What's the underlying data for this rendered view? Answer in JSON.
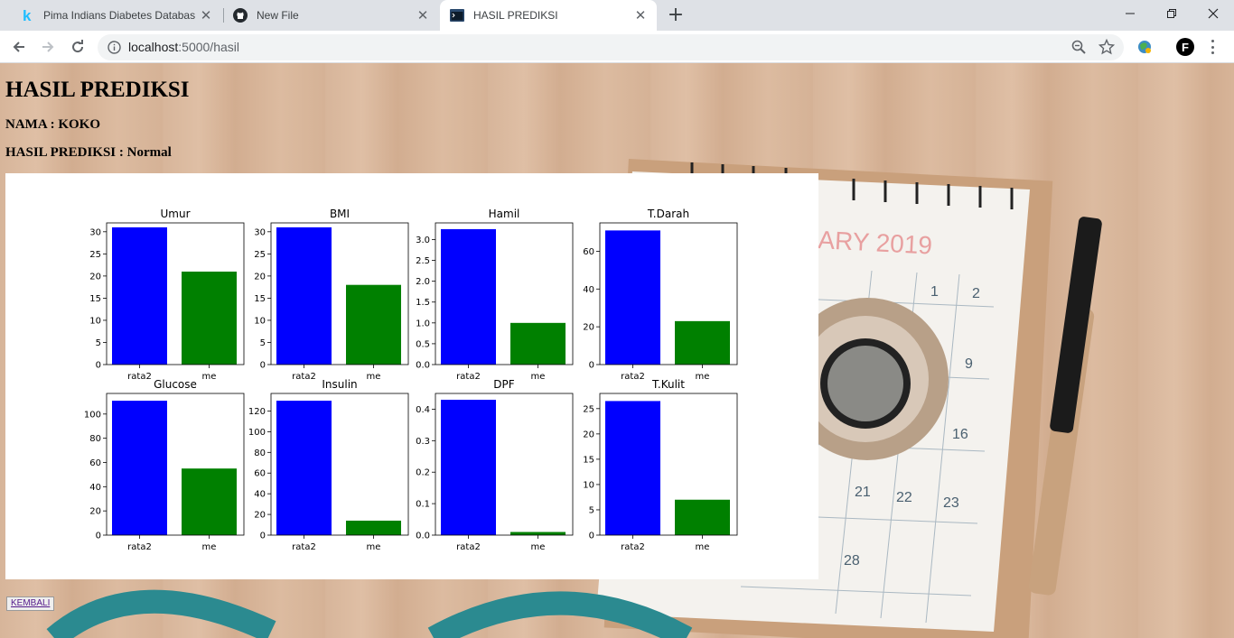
{
  "browser": {
    "tabs": [
      {
        "title": "Pima Indians Diabetes Database |",
        "favicon": "kaggle-k-icon",
        "active": false
      },
      {
        "title": "New File",
        "favicon": "github-icon",
        "active": false
      },
      {
        "title": "HASIL PREDIKSI",
        "favicon": "terminal-icon",
        "active": true
      }
    ],
    "url_host": "localhost",
    "url_path": ":5000/hasil",
    "profile_initial": "F"
  },
  "page": {
    "title": "HASIL PREDIKSI",
    "name_line": "NAMA : KOKO",
    "result_line": "HASIL PREDIKSI : Normal",
    "back_label": "KEMBALI"
  },
  "colors": {
    "bar_avg": "#0000ff",
    "bar_me": "#008000"
  },
  "chart_data": [
    {
      "type": "bar",
      "title": "Umur",
      "categories": [
        "rata2",
        "me"
      ],
      "values": [
        31,
        21
      ],
      "ylim": [
        0,
        32
      ],
      "yticks": [
        0,
        5,
        10,
        15,
        20,
        25,
        30
      ]
    },
    {
      "type": "bar",
      "title": "BMI",
      "categories": [
        "rata2",
        "me"
      ],
      "values": [
        31,
        18
      ],
      "ylim": [
        0,
        32
      ],
      "yticks": [
        0,
        5,
        10,
        15,
        20,
        25,
        30
      ]
    },
    {
      "type": "bar",
      "title": "Hamil",
      "categories": [
        "rata2",
        "me"
      ],
      "values": [
        3.25,
        1.0
      ],
      "ylim": [
        0,
        3.4
      ],
      "yticks": [
        0.0,
        0.5,
        1.0,
        1.5,
        2.0,
        2.5,
        3.0
      ],
      "decimals": 1
    },
    {
      "type": "bar",
      "title": "T.Darah",
      "categories": [
        "rata2",
        "me"
      ],
      "values": [
        71,
        23
      ],
      "ylim": [
        0,
        75
      ],
      "yticks": [
        0,
        20,
        40,
        60
      ]
    },
    {
      "type": "bar",
      "title": "Glucose",
      "categories": [
        "rata2",
        "me"
      ],
      "values": [
        111,
        55
      ],
      "ylim": [
        0,
        117
      ],
      "yticks": [
        0,
        20,
        40,
        60,
        80,
        100
      ]
    },
    {
      "type": "bar",
      "title": "Insulin",
      "categories": [
        "rata2",
        "me"
      ],
      "values": [
        130,
        14
      ],
      "ylim": [
        0,
        137
      ],
      "yticks": [
        0,
        20,
        40,
        60,
        80,
        100,
        120
      ]
    },
    {
      "type": "bar",
      "title": "DPF",
      "categories": [
        "rata2",
        "me"
      ],
      "values": [
        0.43,
        0.01
      ],
      "ylim": [
        0,
        0.45
      ],
      "yticks": [
        0.0,
        0.1,
        0.2,
        0.3,
        0.4
      ],
      "decimals": 1
    },
    {
      "type": "bar",
      "title": "T.Kulit",
      "categories": [
        "rata2",
        "me"
      ],
      "values": [
        26.5,
        7
      ],
      "ylim": [
        0,
        28
      ],
      "yticks": [
        0,
        5,
        10,
        15,
        20,
        25
      ]
    }
  ]
}
